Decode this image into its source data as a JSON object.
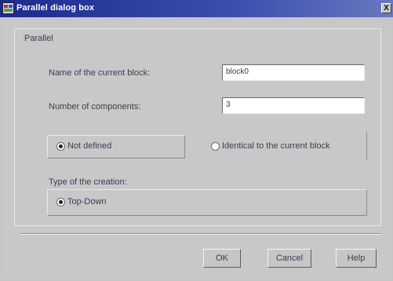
{
  "window": {
    "title": "Parallel dialog box",
    "close_glyph": "X",
    "icon": "app-dialog-icon"
  },
  "group": {
    "legend": "Parallel"
  },
  "fields": {
    "block_name_label": "Name of the current block:",
    "block_name_value": "block0",
    "components_label": "Number of components:",
    "components_value": "3"
  },
  "radios": {
    "not_defined_label": "Not defined",
    "not_defined_checked": true,
    "identical_label": "Identical to the current block",
    "identical_checked": false
  },
  "creation": {
    "label": "Type of the creation:",
    "top_down_label": "Top-Down",
    "top_down_checked": true
  },
  "buttons": {
    "ok": "OK",
    "cancel": "Cancel",
    "help": "Help"
  }
}
